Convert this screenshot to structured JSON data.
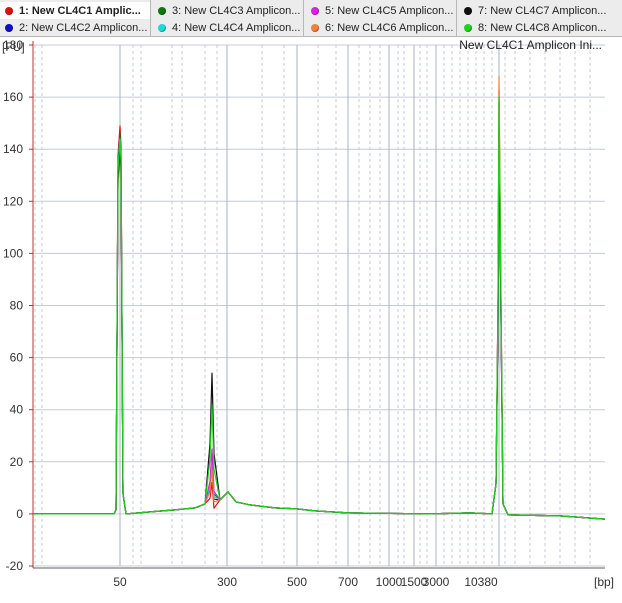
{
  "legend": [
    {
      "label": "1: New CL4C1 Amplic...",
      "color": "#e01010",
      "active": true
    },
    {
      "label": "2: New CL4C2 Amplicon...",
      "color": "#1010c8",
      "active": false
    },
    {
      "label": "3: New CL4C3 Amplicon...",
      "color": "#0a7a0a",
      "active": false
    },
    {
      "label": "4: New CL4C4 Amplicon...",
      "color": "#20d8d8",
      "active": false
    },
    {
      "label": "5: New CL4C5 Amplicon...",
      "color": "#e020e0",
      "active": false
    },
    {
      "label": "6: New CL4C6 Amplicon...",
      "color": "#f08040",
      "active": false
    },
    {
      "label": "7: New CL4C7 Amplicon...",
      "color": "#101010",
      "active": false
    },
    {
      "label": "8: New CL4C8 Amplicon...",
      "color": "#20d020",
      "active": false
    }
  ],
  "chart_data": {
    "type": "line",
    "title": "New CL4C1 Amplicon Ini...",
    "ylabel": "[FU]",
    "xlabel": "[bp]",
    "ylim": [
      -20,
      180
    ],
    "yticks": [
      -20,
      0,
      20,
      40,
      60,
      80,
      100,
      120,
      140,
      160,
      180
    ],
    "xticks": [
      "50",
      "300",
      "500",
      "700",
      "1000",
      "1500",
      "3000",
      "10380"
    ],
    "grid": true,
    "series": [
      {
        "name": "1: New CL4C1 Amplic...",
        "color": "#e01010",
        "x": [
          "35",
          "50",
          "150",
          "300",
          "500",
          "700",
          "1000",
          "3000",
          "10380",
          "15000"
        ],
        "y": [
          0,
          149,
          2,
          12,
          3,
          1,
          0,
          0,
          163,
          -2
        ]
      },
      {
        "name": "2: New CL4C2 Amplicon...",
        "color": "#1010c8",
        "x": [
          "35",
          "50",
          "150",
          "300",
          "500",
          "700",
          "1000",
          "3000",
          "10380",
          "15000"
        ],
        "y": [
          0,
          141,
          2,
          19,
          2,
          1,
          0,
          0,
          150,
          -2
        ]
      },
      {
        "name": "3: New CL4C3 Amplicon...",
        "color": "#0a7a0a",
        "x": [
          "35",
          "50",
          "150",
          "300",
          "500",
          "700",
          "1000",
          "3000",
          "10380",
          "15000"
        ],
        "y": [
          0,
          146,
          2,
          23,
          3,
          1,
          0,
          0,
          158,
          -2
        ]
      },
      {
        "name": "4: New CL4C4 Amplicon...",
        "color": "#20d8d8",
        "x": [
          "35",
          "50",
          "150",
          "300",
          "500",
          "700",
          "1000",
          "3000",
          "10380",
          "15000"
        ],
        "y": [
          0,
          144,
          3,
          21,
          2,
          1,
          0,
          0,
          153,
          -2
        ]
      },
      {
        "name": "5: New CL4C5 Amplicon...",
        "color": "#e020e0",
        "x": [
          "35",
          "50",
          "150",
          "300",
          "500",
          "700",
          "1000",
          "3000",
          "10380",
          "15000"
        ],
        "y": [
          0,
          142,
          2,
          25,
          3,
          1,
          0,
          0,
          152,
          -2
        ]
      },
      {
        "name": "6: New CL4C6 Amplicon...",
        "color": "#f08040",
        "x": [
          "35",
          "50",
          "150",
          "300",
          "500",
          "700",
          "1000",
          "3000",
          "10380",
          "15000"
        ],
        "y": [
          0,
          138,
          2,
          17,
          2,
          1,
          0,
          0,
          168,
          -2
        ]
      },
      {
        "name": "7: New CL4C7 Amplicon...",
        "color": "#101010",
        "x": [
          "35",
          "50",
          "150",
          "300",
          "500",
          "700",
          "1000",
          "3000",
          "10380",
          "15000"
        ],
        "y": [
          0,
          140,
          2,
          54,
          3,
          1,
          0,
          0,
          148,
          -2
        ]
      },
      {
        "name": "8: New CL4C8 Amplicon...",
        "color": "#20d020",
        "x": [
          "35",
          "50",
          "150",
          "300",
          "500",
          "700",
          "1000",
          "3000",
          "10380",
          "15000"
        ],
        "y": [
          0,
          143,
          2,
          42,
          3,
          1,
          0,
          0,
          160,
          -2
        ]
      }
    ]
  }
}
